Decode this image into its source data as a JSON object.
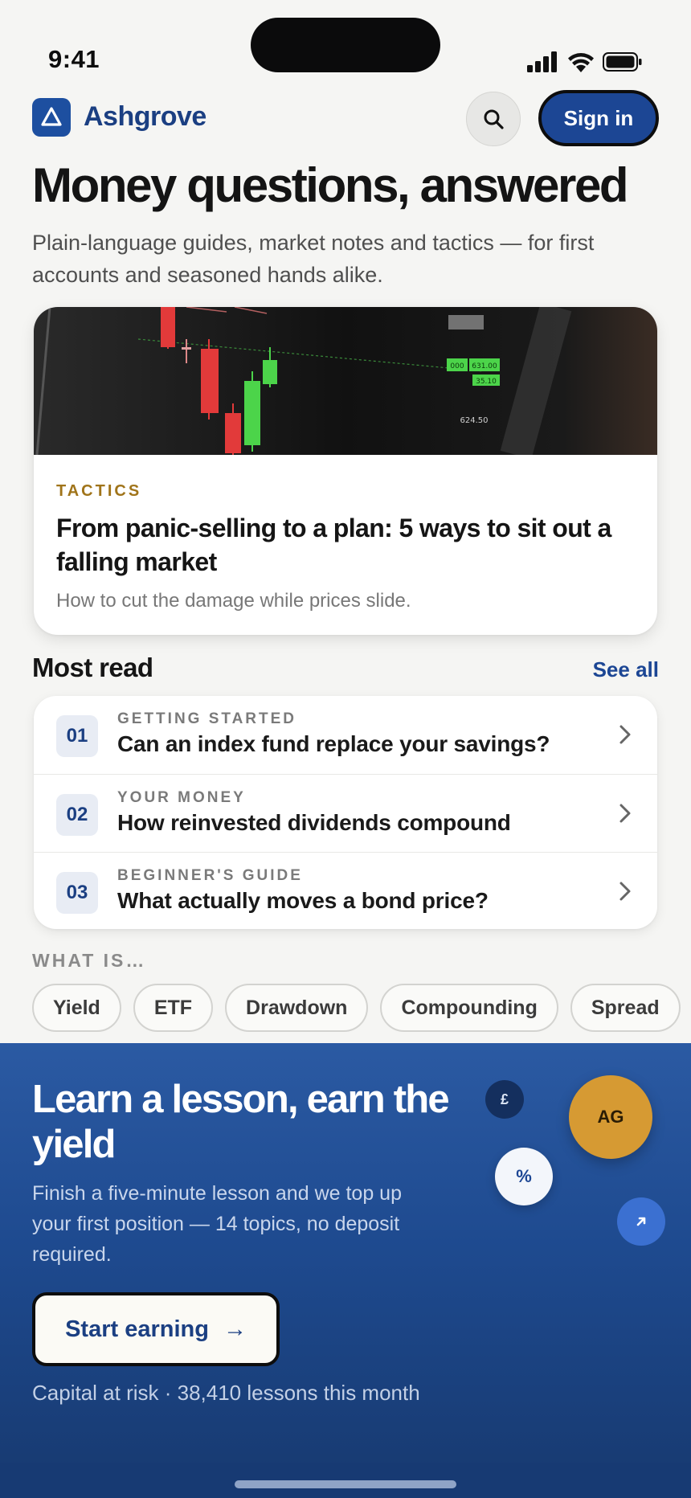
{
  "status_bar": {
    "time": "9:41"
  },
  "header": {
    "brand": "Ashgrove",
    "sign_in": "Sign in"
  },
  "hero": {
    "title": "Money questions, answered",
    "subtitle": "Plain-language guides, market notes and tactics — for first accounts and seasoned hands alike."
  },
  "featured": {
    "kicker": "TACTICS",
    "title": "From panic-selling to a plan: 5 ways to sit out a falling market",
    "dek": "How to cut the damage while prices slide.",
    "image_labels": [
      "000",
      "631.00",
      "35.10",
      "624.50"
    ]
  },
  "most_read": {
    "title": "Most read",
    "see_all": "See all",
    "items": [
      {
        "rank": "01",
        "kicker": "GETTING STARTED",
        "title": "Can an index fund replace your savings?"
      },
      {
        "rank": "02",
        "kicker": "YOUR MONEY",
        "title": "How reinvested dividends compound"
      },
      {
        "rank": "03",
        "kicker": "BEGINNER'S GUIDE",
        "title": "What actually moves a bond price?"
      }
    ]
  },
  "what_is": {
    "label": "WHAT IS…",
    "chips": [
      "Yield",
      "ETF",
      "Drawdown",
      "Compounding",
      "Spread"
    ]
  },
  "promo": {
    "title": "Learn a lesson, earn the yield",
    "body": "Finish a five-minute lesson and we top up your first position — 14 topics, no deposit required.",
    "cta": "Start earning",
    "cta_arrow": "→",
    "footnote": "Capital at risk · 38,410 lessons this month",
    "coins": {
      "pound": "£",
      "ag": "AG",
      "percent": "%"
    }
  },
  "colors": {
    "brand": "#1c4694",
    "accent_gold": "#a0741a",
    "candle_up": "#4cd44a",
    "candle_down": "#e23a3a"
  }
}
